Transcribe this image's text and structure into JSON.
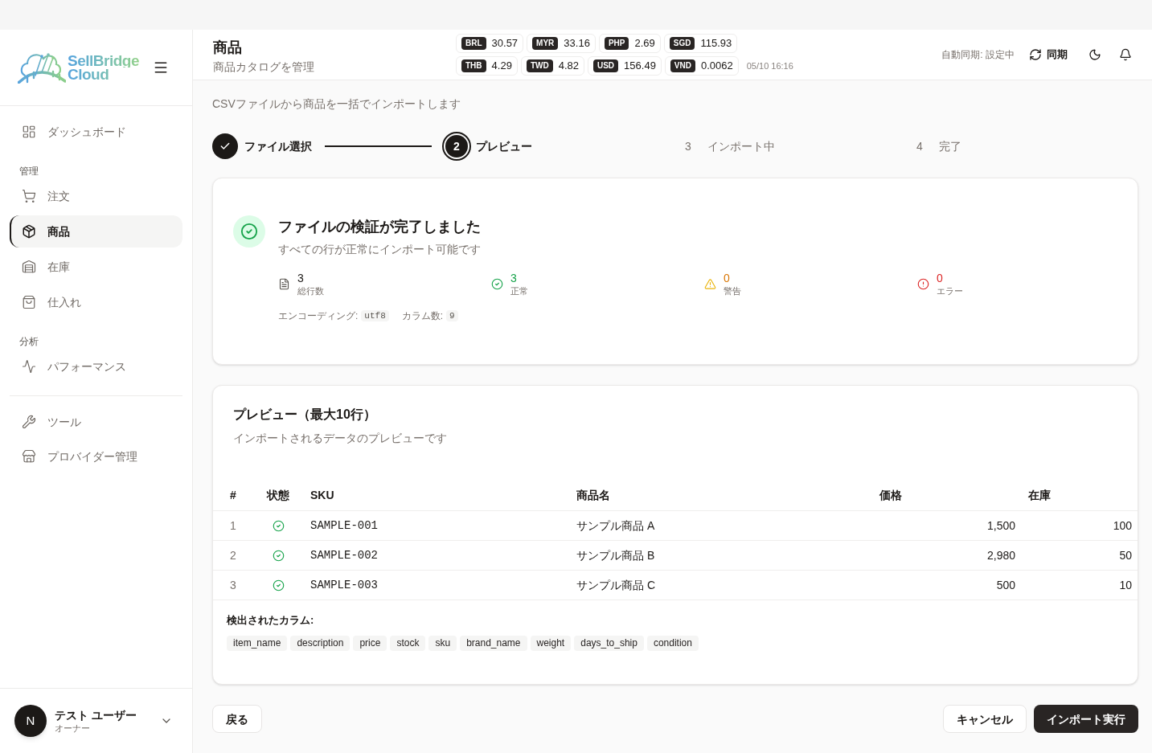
{
  "sidebar": {
    "logo": {
      "lines": [
        "SellBridge",
        "Cloud"
      ]
    },
    "nav_groups": [
      {
        "items": [
          {
            "label": "ダッシュボード",
            "selected": false
          }
        ]
      },
      {
        "heading": "管理",
        "items": [
          {
            "label": "注文",
            "selected": false
          },
          {
            "label": "商品",
            "selected": true
          },
          {
            "label": "在庫",
            "selected": false
          },
          {
            "label": "仕入れ",
            "selected": false
          }
        ]
      },
      {
        "heading": "分析",
        "items": [
          {
            "label": "パフォーマンス",
            "selected": false
          }
        ]
      }
    ],
    "tools": [
      {
        "label": "ツール",
        "selected": false
      },
      {
        "label": "プロバイダー管理",
        "selected": false
      }
    ],
    "user": {
      "initial": "N",
      "name": "テスト ユーザー",
      "role": "オーナー"
    }
  },
  "header": {
    "title": "商品",
    "subtitle": "商品カタログを管理",
    "rates": [
      {
        "code": "BRL",
        "value": "30.57"
      },
      {
        "code": "MYR",
        "value": "33.16"
      },
      {
        "code": "PHP",
        "value": "2.69"
      },
      {
        "code": "SGD",
        "value": "115.93"
      },
      {
        "code": "THB",
        "value": "4.29"
      },
      {
        "code": "TWD",
        "value": "4.82"
      },
      {
        "code": "USD",
        "value": "156.49"
      },
      {
        "code": "VND",
        "value": "0.0062"
      }
    ],
    "rates_updated": "05/10 16:16",
    "auto_sync": "自動同期: 設定中",
    "sync_button": "同期"
  },
  "page": {
    "subtitle": "CSVファイルから商品を一括でインポートします"
  },
  "steps": [
    {
      "label": "ファイル選択",
      "completed": true,
      "selected": false
    },
    {
      "number": "2",
      "label": "プレビュー",
      "completed": false,
      "selected": true
    },
    {
      "number": "3",
      "label": "インポート中",
      "completed": false,
      "selected": false
    },
    {
      "number": "4",
      "label": "完了",
      "completed": false,
      "selected": false
    }
  ],
  "validation": {
    "title": "ファイルの検証が完了しました",
    "description": "すべての行が正常にインポート可能です",
    "stats": [
      {
        "kind": "total",
        "value": "3",
        "label": "総行数"
      },
      {
        "kind": "valid",
        "value": "3",
        "label": "正常"
      },
      {
        "kind": "warning",
        "value": "0",
        "label": "警告"
      },
      {
        "kind": "error",
        "value": "0",
        "label": "エラー"
      }
    ],
    "encoding_label": "エンコーディング:",
    "encoding": "utf8",
    "column_count_label": "カラム数:",
    "column_count": "9"
  },
  "preview": {
    "title": "プレビュー（最大10行）",
    "description": "インポートされるデータのプレビューです",
    "table": {
      "columns": [
        "#",
        "状態",
        "SKU",
        "商品名",
        "価格",
        "在庫"
      ],
      "rows": [
        {
          "index": "1",
          "valid": true,
          "sku": "SAMPLE-001",
          "name": "サンプル商品 A",
          "price": "1,500",
          "stock": "100"
        },
        {
          "index": "2",
          "valid": true,
          "sku": "SAMPLE-002",
          "name": "サンプル商品 B",
          "price": "2,980",
          "stock": "50"
        },
        {
          "index": "3",
          "valid": true,
          "sku": "SAMPLE-003",
          "name": "サンプル商品 C",
          "price": "500",
          "stock": "10"
        }
      ]
    },
    "detected_label": "検出されたカラム:",
    "detected_columns": [
      "item_name",
      "description",
      "price",
      "stock",
      "sku",
      "brand_name",
      "weight",
      "days_to_ship",
      "condition"
    ]
  },
  "actions": {
    "back": "戻る",
    "cancel": "キャンセル",
    "submit": "インポート実行"
  }
}
